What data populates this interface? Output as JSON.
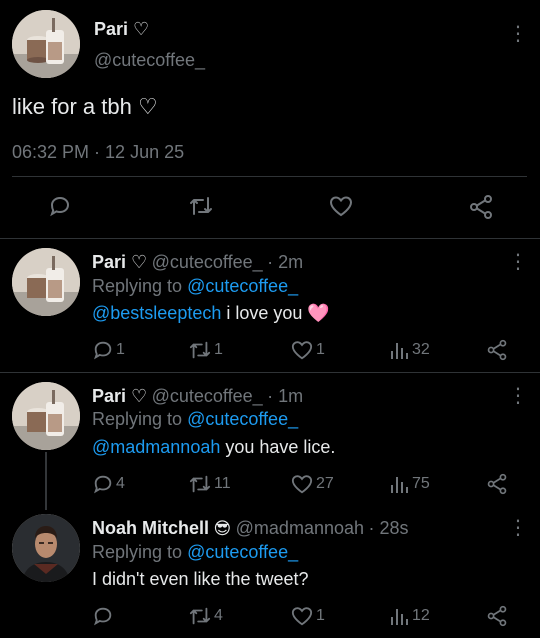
{
  "main_tweet": {
    "display_name": "Pari ♡",
    "handle": "@cutecoffee_",
    "text": "like for a tbh ♡",
    "timestamp": "06:32 PM · 12 Jun 25"
  },
  "replies": [
    {
      "display_name": "Pari ♡",
      "handle": "@cutecoffee_",
      "age": "· 2m",
      "replying_prefix": "Replying to",
      "replying_to": "@cutecoffee_",
      "mention": "@bestsleeptech",
      "text": " i love you",
      "emoji": "🩷",
      "stats": {
        "replies": "1",
        "retweets": "1",
        "likes": "1",
        "views": "32"
      }
    },
    {
      "display_name": "Pari ♡",
      "handle": "@cutecoffee_",
      "age": "· 1m",
      "replying_prefix": "Replying to",
      "replying_to": "@cutecoffee_",
      "mention": "@madmannoah",
      "text": " you have lice.",
      "stats": {
        "replies": "4",
        "retweets": "11",
        "likes": "27",
        "views": "75"
      }
    },
    {
      "display_name": "Noah Mitchell",
      "emoji": "😎",
      "handle": "@madmannoah",
      "age": "· 28s",
      "replying_prefix": "Replying to",
      "replying_to": "@cutecoffee_",
      "text": "I didn't even like the tweet?",
      "stats": {
        "replies": "",
        "retweets": "4",
        "likes": "1",
        "views": "12"
      }
    }
  ],
  "more_glyph": "⋮",
  "colors": {
    "background": "#000000",
    "text": "#e7e9ea",
    "muted": "#71767b",
    "link": "#1d9bf0",
    "divider": "#2f3336"
  },
  "icons": [
    "reply-icon",
    "retweet-icon",
    "like-icon",
    "views-icon",
    "share-icon",
    "more-icon"
  ]
}
